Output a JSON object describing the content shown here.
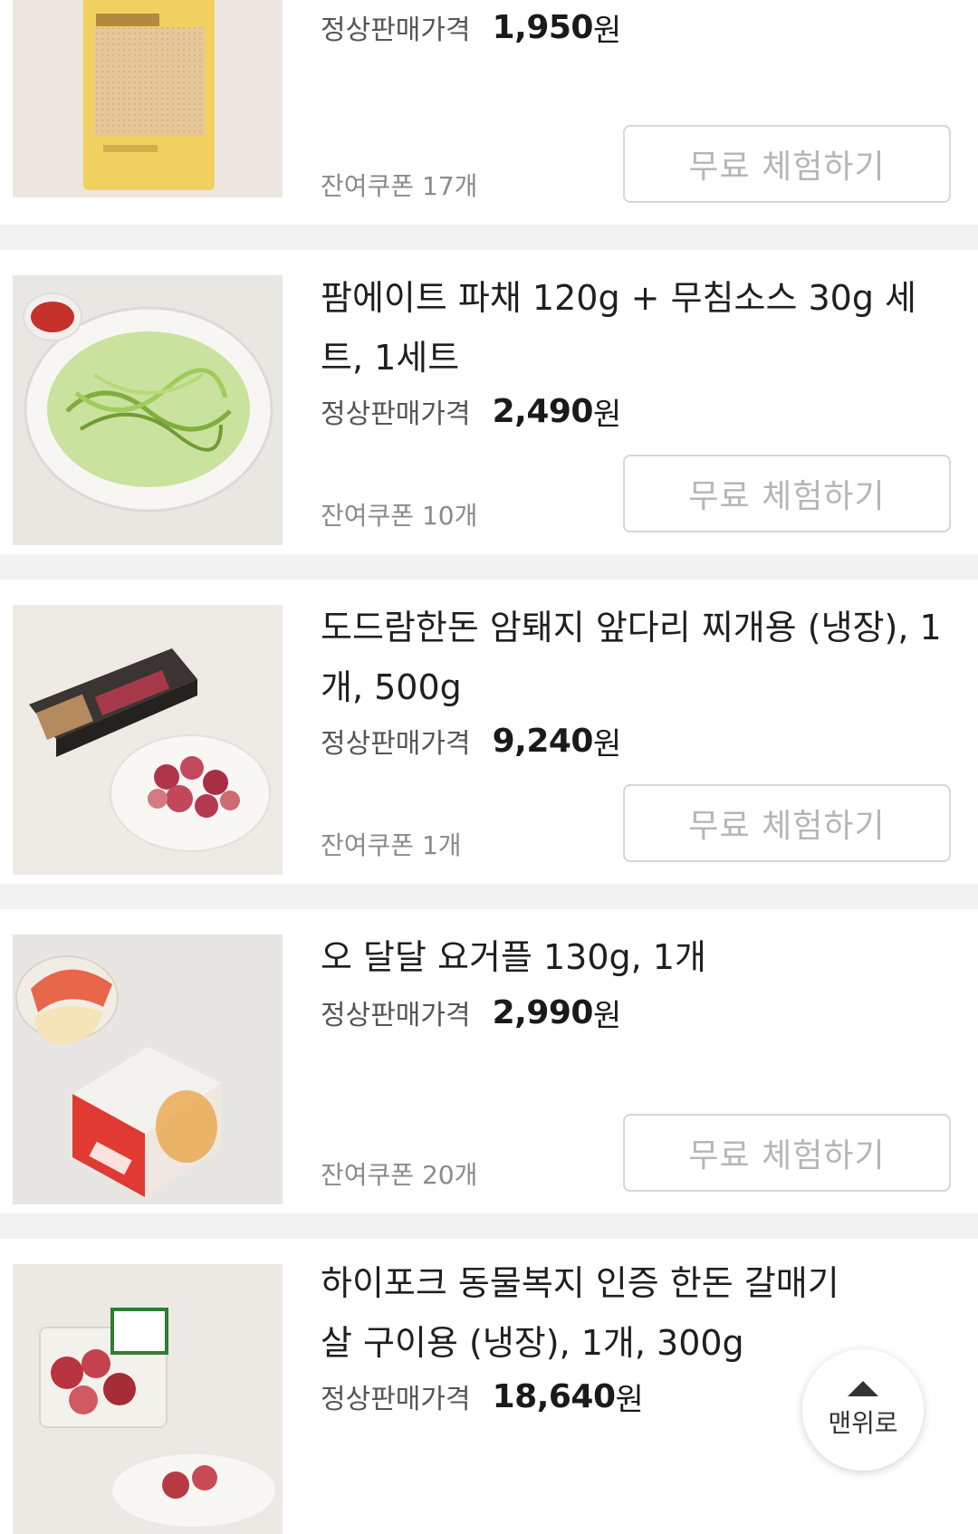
{
  "colors": {
    "divider": "#f2f2f2",
    "button_border": "#d6d6d6",
    "button_text": "#b6b6b6"
  },
  "products": [
    {
      "title": "",
      "price_label": "정상판매가격",
      "price": "1,950",
      "unit": "원",
      "remaining": "잔여쿠폰 17개",
      "button": "무료 체험하기",
      "image_icon": "fish-cake-package-image"
    },
    {
      "title": "팜에이트 파채 120g + 무침소스 30g 세트, 1세트",
      "price_label": "정상판매가격",
      "price": "2,490",
      "unit": "원",
      "remaining": "잔여쿠폰 10개",
      "button": "무료 체험하기",
      "image_icon": "green-onion-salad-image"
    },
    {
      "title": "도드람한돈 암퇘지 앞다리 찌개용 (냉장), 1개, 500g",
      "price_label": "정상판매가격",
      "price": "9,240",
      "unit": "원",
      "remaining": "잔여쿠폰 1개",
      "button": "무료 체험하기",
      "image_icon": "pork-box-image"
    },
    {
      "title": "오 달달 요거플 130g, 1개",
      "price_label": "정상판매가격",
      "price": "2,990",
      "unit": "원",
      "remaining": "잔여쿠폰 20개",
      "button": "무료 체험하기",
      "image_icon": "yogurt-cup-image"
    },
    {
      "title": "하이포크 동물복지 인증 한돈 갈매기살 구이용 (냉장), 1개, 300g",
      "price_label": "정상판매가격",
      "price": "18,640",
      "unit": "원",
      "remaining": "",
      "button": "",
      "image_icon": "pork-tray-image"
    }
  ],
  "scroll_top": {
    "label": "맨위로",
    "icon": "arrow-up-icon"
  }
}
